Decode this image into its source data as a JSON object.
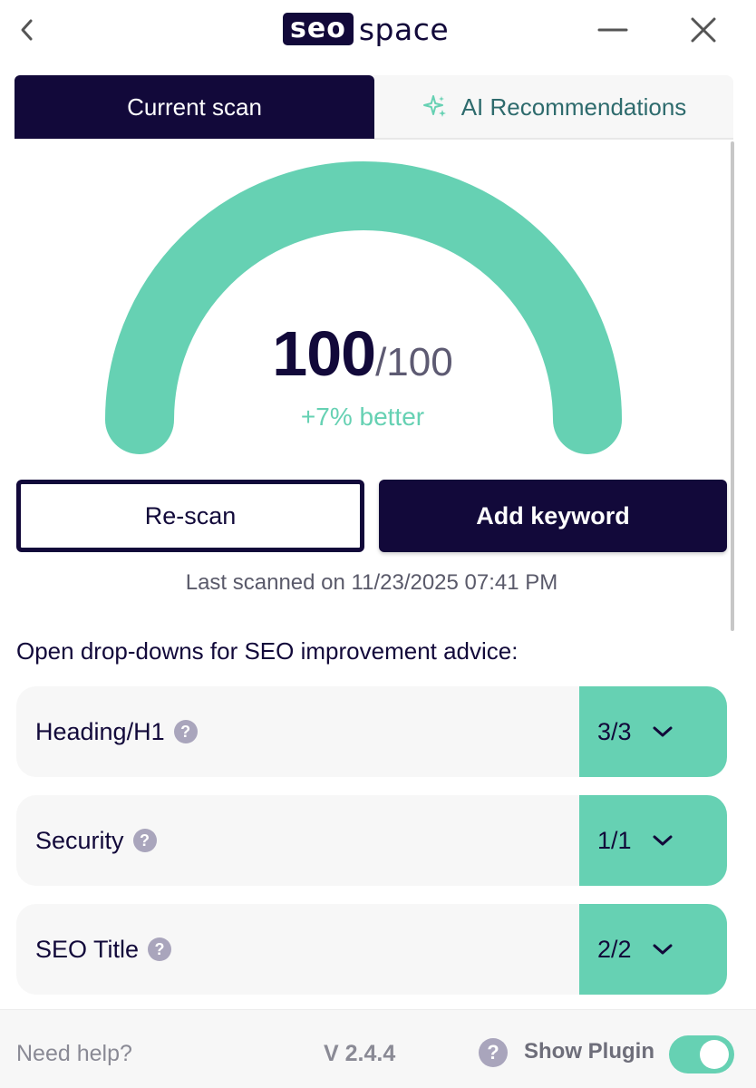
{
  "brand": {
    "logo_left": "seo",
    "logo_right": "space"
  },
  "tabs": [
    {
      "label": "Current scan",
      "active": true
    },
    {
      "label": "AI Recommendations",
      "active": false
    }
  ],
  "score": {
    "value": "100",
    "max": "/100",
    "change": "+7% better",
    "fraction": 1.0
  },
  "actions": {
    "rescan_label": "Re-scan",
    "add_keyword_label": "Add keyword"
  },
  "last_scanned": "Last scanned on 11/23/2025 07:41 PM",
  "advice_heading": "Open drop-downs for SEO improvement advice:",
  "checks": [
    {
      "label": "Heading/H1",
      "score": "3/3"
    },
    {
      "label": "Security",
      "score": "1/1"
    },
    {
      "label": "SEO Title",
      "score": "2/2"
    }
  ],
  "footer": {
    "need_help": "Need help?",
    "version": "V 2.4.4",
    "show_plugin": "Show Plugin",
    "show_plugin_enabled": true
  },
  "colors": {
    "navy": "#12093a",
    "accent_green": "#66d1b3",
    "teal_text": "#2e6b6d",
    "panel_bg": "#f7f7f7"
  },
  "icons": {
    "back": "chevron-left-icon",
    "minimize": "minimize-icon",
    "close": "close-icon",
    "ai": "sparkle-icon",
    "help": "question-mark-icon",
    "expand": "chevron-down-icon"
  }
}
